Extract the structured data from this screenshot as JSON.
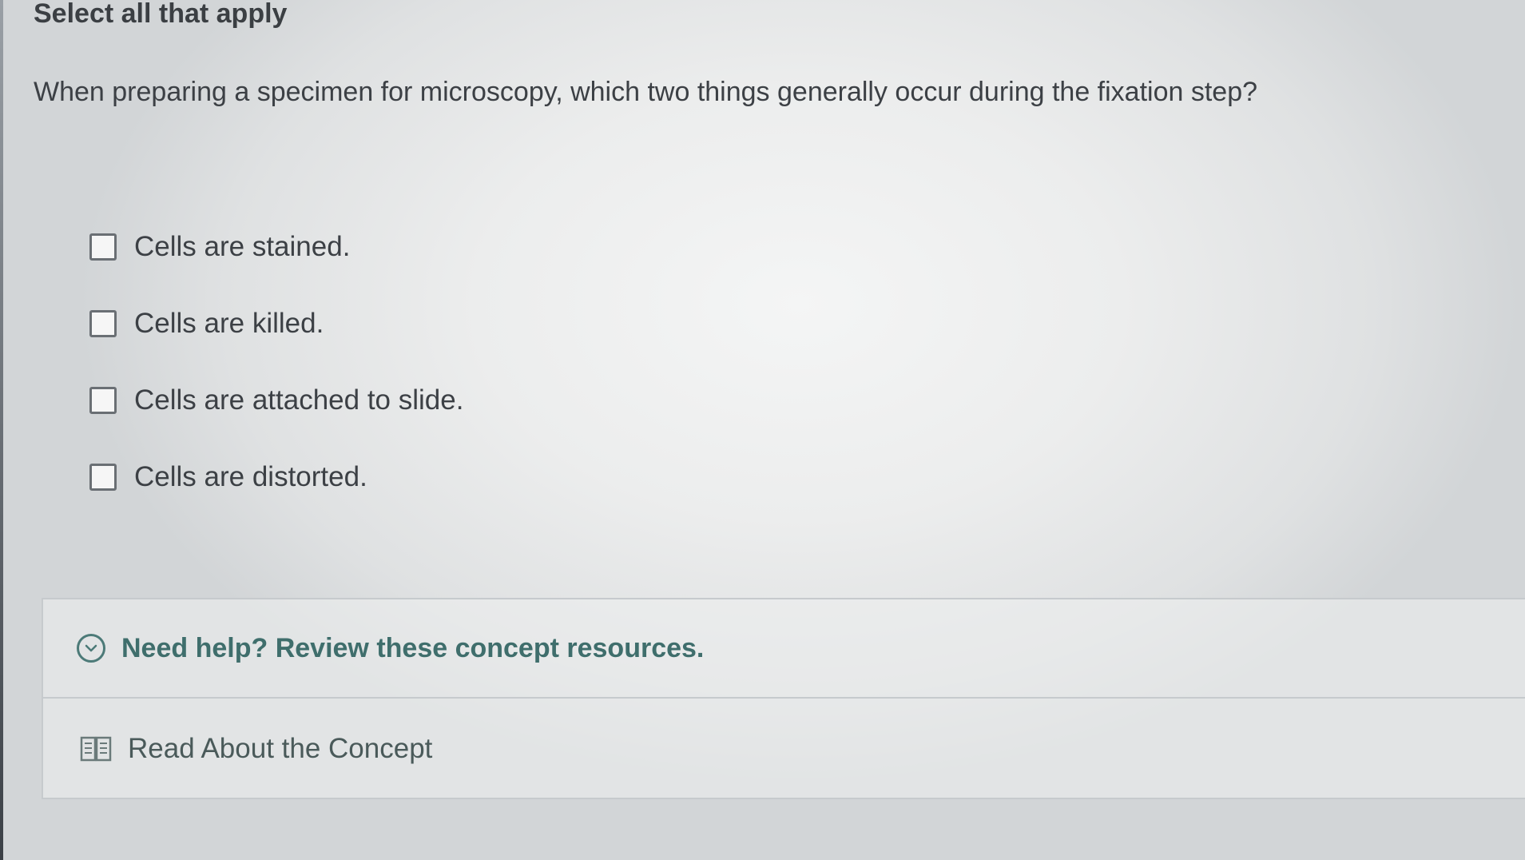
{
  "instruction": "Select all that apply",
  "question": "When preparing a specimen for microscopy, which two things generally occur during the fixation step?",
  "options": [
    {
      "label": "Cells are stained.",
      "checked": false
    },
    {
      "label": "Cells are killed.",
      "checked": false
    },
    {
      "label": "Cells are attached to slide.",
      "checked": false
    },
    {
      "label": "Cells are distorted.",
      "checked": false
    }
  ],
  "help": {
    "title": "Need help? Review these concept resources.",
    "icon": "chevron-down-icon",
    "resources": [
      {
        "label": "Read About the Concept",
        "icon": "book-icon"
      }
    ]
  },
  "colors": {
    "accent": "#3f6e6c",
    "text": "#3c4045",
    "border": "#c6cacd"
  }
}
